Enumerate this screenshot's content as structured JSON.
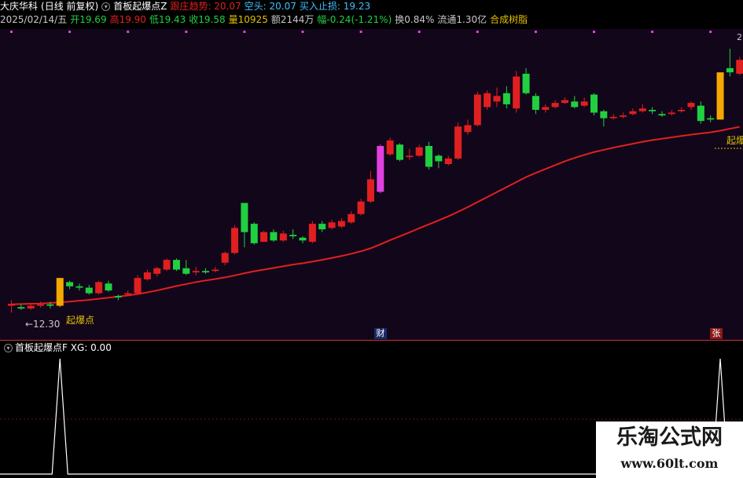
{
  "header": {
    "stock_name": "大庆华科",
    "period": "(日线 前复权)",
    "indicator_name": "首板起爆点Z",
    "follow_label": "跟庄趋势: 20.07",
    "short_label": "空头: 20.07",
    "stop_label": "买入止损: 19.23",
    "date": "2025/02/14/五",
    "open": "开19.69",
    "high": "高19.90",
    "low": "低19.43",
    "close": "收19.58",
    "volume": "量10925",
    "amount": "额2144万",
    "change": "幅-0.24(-1.21%)",
    "turnover": "换0.84%",
    "float_cap": "流通1.30亿",
    "sector": "合成树脂"
  },
  "colors": {
    "up": "#e02020",
    "down": "#20d040",
    "ma": "#e02020",
    "signal": "#f5a800",
    "magenta": "#e040e0",
    "text": "#c8c8c8",
    "yellow": "#e0c000",
    "cyan": "#40c0ff"
  },
  "annotations": {
    "low_price": "←12.30",
    "signal_label_left": "起爆点",
    "signal_label_right": "起爆",
    "top_right_price": "2"
  },
  "badges": {
    "cai": "财",
    "zhang": "张"
  },
  "indicator": {
    "title": "首板起爆点F",
    "xg_label": "XG: 0.00"
  },
  "watermark": {
    "title": "乐淘公式网",
    "url": "www.60lt.com"
  },
  "chart_data": {
    "type": "candlestick",
    "price_range": [
      12.0,
      22.0
    ],
    "candles": [
      {
        "o": 12.55,
        "c": 12.62,
        "h": 12.75,
        "l": 12.3
      },
      {
        "o": 12.5,
        "c": 12.45,
        "h": 12.6,
        "l": 12.4
      },
      {
        "o": 12.45,
        "c": 12.55,
        "h": 12.62,
        "l": 12.4
      },
      {
        "o": 12.55,
        "c": 12.6,
        "h": 12.7,
        "l": 12.48
      },
      {
        "o": 12.6,
        "c": 12.55,
        "h": 12.7,
        "l": 12.45
      },
      {
        "o": 12.55,
        "c": 13.55,
        "h": 13.55,
        "l": 12.5,
        "sig": true
      },
      {
        "o": 13.4,
        "c": 13.25,
        "h": 13.45,
        "l": 13.15
      },
      {
        "o": 13.25,
        "c": 13.2,
        "h": 13.35,
        "l": 13.1
      },
      {
        "o": 13.2,
        "c": 13.0,
        "h": 13.3,
        "l": 12.95
      },
      {
        "o": 13.0,
        "c": 13.4,
        "h": 13.45,
        "l": 12.95
      },
      {
        "o": 13.35,
        "c": 13.1,
        "h": 13.45,
        "l": 13.05
      },
      {
        "o": 12.9,
        "c": 12.85,
        "h": 12.95,
        "l": 12.75
      },
      {
        "o": 12.95,
        "c": 13.0,
        "h": 13.1,
        "l": 12.9
      },
      {
        "o": 13.0,
        "c": 13.55,
        "h": 13.65,
        "l": 12.95
      },
      {
        "o": 13.5,
        "c": 13.75,
        "h": 13.85,
        "l": 13.45
      },
      {
        "o": 13.7,
        "c": 13.9,
        "h": 13.95,
        "l": 13.6
      },
      {
        "o": 13.85,
        "c": 14.2,
        "h": 14.25,
        "l": 13.8
      },
      {
        "o": 14.2,
        "c": 13.85,
        "h": 14.25,
        "l": 13.8
      },
      {
        "o": 13.9,
        "c": 13.7,
        "h": 14.2,
        "l": 13.65
      },
      {
        "o": 13.75,
        "c": 13.8,
        "h": 13.95,
        "l": 13.65
      },
      {
        "o": 13.8,
        "c": 13.75,
        "h": 13.9,
        "l": 13.7
      },
      {
        "o": 13.8,
        "c": 13.85,
        "h": 13.95,
        "l": 13.75
      },
      {
        "o": 14.1,
        "c": 14.45,
        "h": 14.5,
        "l": 14.0
      },
      {
        "o": 14.45,
        "c": 15.35,
        "h": 15.45,
        "l": 14.4
      },
      {
        "o": 16.25,
        "c": 15.2,
        "h": 16.25,
        "l": 14.65
      },
      {
        "o": 15.5,
        "c": 14.8,
        "h": 15.55,
        "l": 14.75
      },
      {
        "o": 14.85,
        "c": 15.2,
        "h": 15.25,
        "l": 14.85
      },
      {
        "o": 15.2,
        "c": 14.9,
        "h": 15.3,
        "l": 14.85
      },
      {
        "o": 14.9,
        "c": 15.15,
        "h": 15.25,
        "l": 14.85
      },
      {
        "o": 15.1,
        "c": 15.05,
        "h": 15.3,
        "l": 14.95
      },
      {
        "o": 15.0,
        "c": 14.9,
        "h": 15.05,
        "l": 14.8
      },
      {
        "o": 14.85,
        "c": 15.5,
        "h": 15.6,
        "l": 14.8
      },
      {
        "o": 15.5,
        "c": 15.3,
        "h": 15.6,
        "l": 15.2
      },
      {
        "o": 15.35,
        "c": 15.55,
        "h": 15.65,
        "l": 15.3
      },
      {
        "o": 15.4,
        "c": 15.6,
        "h": 15.7,
        "l": 15.35
      },
      {
        "o": 15.55,
        "c": 15.85,
        "h": 15.95,
        "l": 15.5
      },
      {
        "o": 15.85,
        "c": 16.3,
        "h": 16.4,
        "l": 15.8
      },
      {
        "o": 16.3,
        "c": 17.1,
        "h": 17.4,
        "l": 16.25
      },
      {
        "o": 16.65,
        "c": 18.3,
        "h": 18.35,
        "l": 16.6,
        "mag": true
      },
      {
        "o": 18.0,
        "c": 18.5,
        "h": 18.6,
        "l": 17.95
      },
      {
        "o": 18.35,
        "c": 17.8,
        "h": 18.4,
        "l": 17.75
      },
      {
        "o": 17.9,
        "c": 17.95,
        "h": 18.2,
        "l": 17.8
      },
      {
        "o": 17.95,
        "c": 18.25,
        "h": 18.35,
        "l": 17.9
      },
      {
        "o": 18.3,
        "c": 17.55,
        "h": 18.45,
        "l": 17.45
      },
      {
        "o": 17.95,
        "c": 17.75,
        "h": 18.0,
        "l": 17.5
      },
      {
        "o": 17.65,
        "c": 17.85,
        "h": 17.95,
        "l": 17.6
      },
      {
        "o": 17.85,
        "c": 19.0,
        "h": 19.15,
        "l": 17.8
      },
      {
        "o": 18.8,
        "c": 19.05,
        "h": 19.25,
        "l": 18.7
      },
      {
        "o": 19.05,
        "c": 20.15,
        "h": 20.25,
        "l": 19.0
      },
      {
        "o": 19.7,
        "c": 20.2,
        "h": 20.3,
        "l": 19.6
      },
      {
        "o": 19.9,
        "c": 20.1,
        "h": 20.4,
        "l": 19.7
      },
      {
        "o": 20.2,
        "c": 19.8,
        "h": 20.45,
        "l": 19.65
      },
      {
        "o": 19.65,
        "c": 20.8,
        "h": 21.0,
        "l": 19.5
      },
      {
        "o": 20.9,
        "c": 20.2,
        "h": 21.1,
        "l": 20.15
      },
      {
        "o": 20.1,
        "c": 19.6,
        "h": 20.2,
        "l": 19.45
      },
      {
        "o": 19.6,
        "c": 19.7,
        "h": 19.8,
        "l": 19.5
      },
      {
        "o": 19.7,
        "c": 19.85,
        "h": 19.95,
        "l": 19.65
      },
      {
        "o": 19.85,
        "c": 19.95,
        "h": 20.05,
        "l": 19.8
      },
      {
        "o": 19.9,
        "c": 19.7,
        "h": 20.1,
        "l": 19.65
      },
      {
        "o": 19.75,
        "c": 19.9,
        "h": 20.05,
        "l": 19.7
      },
      {
        "o": 20.15,
        "c": 19.5,
        "h": 20.2,
        "l": 19.4
      },
      {
        "o": 19.55,
        "c": 19.3,
        "h": 19.6,
        "l": 19.0
      },
      {
        "o": 19.3,
        "c": 19.35,
        "h": 19.45,
        "l": 19.25
      },
      {
        "o": 19.35,
        "c": 19.4,
        "h": 19.5,
        "l": 19.3
      },
      {
        "o": 19.45,
        "c": 19.55,
        "h": 19.65,
        "l": 19.4
      },
      {
        "o": 19.55,
        "c": 19.65,
        "h": 19.8,
        "l": 19.5
      },
      {
        "o": 19.6,
        "c": 19.55,
        "h": 19.7,
        "l": 19.45
      },
      {
        "o": 19.45,
        "c": 19.4,
        "h": 19.55,
        "l": 19.35
      },
      {
        "o": 19.45,
        "c": 19.5,
        "h": 19.6,
        "l": 19.4
      },
      {
        "o": 19.55,
        "c": 19.6,
        "h": 19.7,
        "l": 19.5
      },
      {
        "o": 19.7,
        "c": 19.85,
        "h": 19.9,
        "l": 19.6
      },
      {
        "o": 19.75,
        "c": 19.2,
        "h": 19.9,
        "l": 19.1
      },
      {
        "o": 19.3,
        "c": 19.25,
        "h": 19.4,
        "l": 19.15
      },
      {
        "o": 19.25,
        "c": 20.95,
        "h": 20.95,
        "l": 19.25,
        "sig": true
      },
      {
        "o": 21.1,
        "c": 20.95,
        "h": 21.8,
        "l": 20.8
      },
      {
        "o": 20.9,
        "c": 21.4,
        "h": 21.5,
        "l": 20.85
      }
    ],
    "ma": [
      12.6,
      12.61,
      12.62,
      12.63,
      12.65,
      12.67,
      12.7,
      12.73,
      12.76,
      12.8,
      12.84,
      12.88,
      12.92,
      12.97,
      13.03,
      13.1,
      13.18,
      13.26,
      13.33,
      13.4,
      13.46,
      13.51,
      13.57,
      13.64,
      13.72,
      13.79,
      13.85,
      13.91,
      13.97,
      14.03,
      14.08,
      14.14,
      14.2,
      14.27,
      14.34,
      14.42,
      14.51,
      14.62,
      14.76,
      14.91,
      15.05,
      15.19,
      15.34,
      15.48,
      15.62,
      15.77,
      15.93,
      16.1,
      16.28,
      16.46,
      16.64,
      16.82,
      17.0,
      17.18,
      17.33,
      17.47,
      17.61,
      17.75,
      17.87,
      17.98,
      18.08,
      18.16,
      18.24,
      18.31,
      18.38,
      18.45,
      18.51,
      18.56,
      18.61,
      18.66,
      18.71,
      18.75,
      18.79,
      18.85,
      18.92,
      18.99
    ],
    "xg_signal_x": [
      5,
      73
    ],
    "xg_range": [
      0,
      1
    ]
  }
}
